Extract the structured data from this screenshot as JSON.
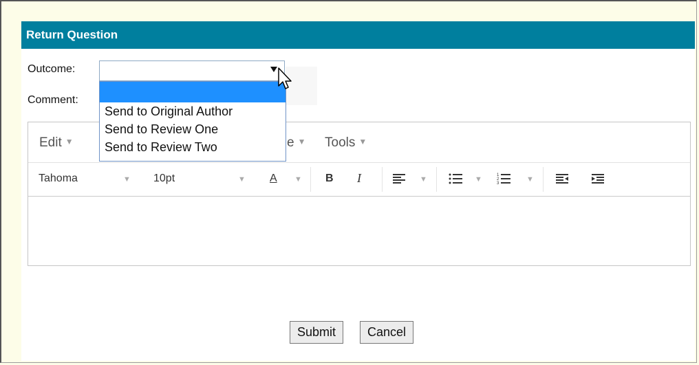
{
  "header": {
    "title": "Return Question"
  },
  "form": {
    "outcome_label": "Outcome:",
    "comment_label": "Comment:",
    "outcome_value": "",
    "outcome_options": [
      "",
      "Send to Original Author",
      "Send to Review One",
      "Send to Review Two"
    ]
  },
  "editor": {
    "menu": {
      "edit": "Edit",
      "hidden_partial": "e",
      "tools": "Tools"
    },
    "toolbar": {
      "font_family": "Tahoma",
      "font_size": "10pt",
      "text_color_icon": "A",
      "bold": "B",
      "italic": "I"
    },
    "content": ""
  },
  "buttons": {
    "submit": "Submit",
    "cancel": "Cancel"
  },
  "colors": {
    "header_bg": "#007f9e",
    "selected_option": "#1e90ff",
    "page_bg": "#fdfde8"
  }
}
